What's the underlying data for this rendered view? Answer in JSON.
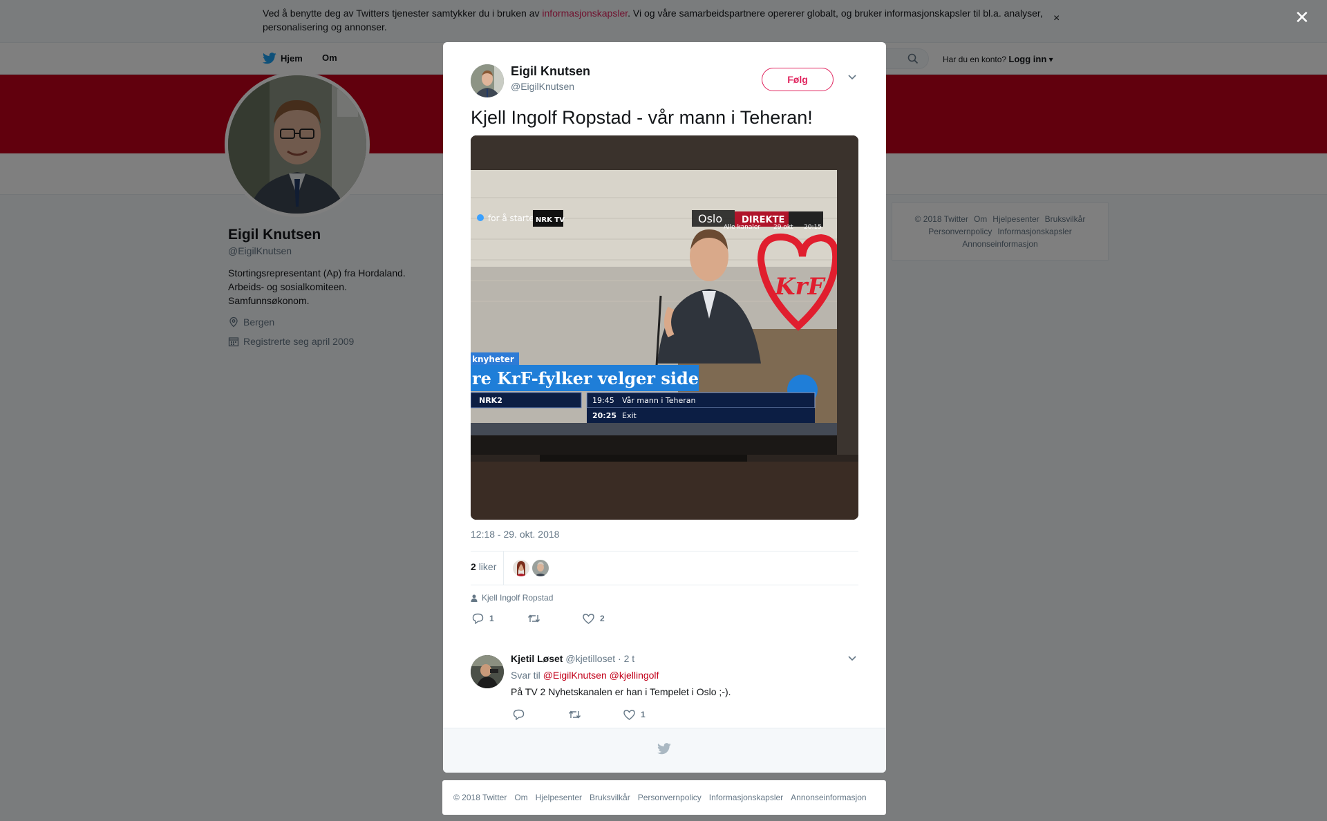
{
  "cookie_bar": {
    "text_before": "Ved å benytte deg av Twitters tjenester samtykker du i bruken av ",
    "link": "informasjonskapsler",
    "text_after": ". Vi og våre samarbeidspartnere opererer globalt, og bruker informasjonskapsler til bl.a. analyser, personalisering og annonser.",
    "close": "×"
  },
  "nav": {
    "home": "Hjem",
    "about": "Om",
    "login_prompt": "Har du en konto?",
    "login": "Logg inn"
  },
  "profile": {
    "name": "Eigil Knutsen",
    "handle": "@EigilKnutsen",
    "bio_lines": [
      "Stortingsrepresentant (Ap) fra Hordaland.",
      "Arbeids- og sosialkomiteen.",
      "Samfunnsøkonom."
    ],
    "location": "Bergen",
    "joined": "Registrerte seg april 2009"
  },
  "side_footer": {
    "row1": [
      "© 2018 Twitter",
      "Om",
      "Hjelpesenter",
      "Bruksvilkår"
    ],
    "row2": [
      "Personvernpolicy",
      "Informasjonskapsler"
    ],
    "row3": [
      "Annonseinformasjon"
    ]
  },
  "tweet": {
    "author_name": "Eigil Knutsen",
    "author_handle": "@EigilKnutsen",
    "follow": "Følg",
    "text": "Kjell Ingolf Ropstad - vår mann i Teheran!",
    "timestamp": "12:18 - 29. okt. 2018",
    "likes_count": "2",
    "likes_label": "liker",
    "tagged": "Kjell Ingolf Ropstad",
    "reply_count": "1",
    "retweet_count": "",
    "like_count": "2"
  },
  "media": {
    "prestart": "for å starte",
    "nrk_tv": "NRK TV",
    "city": "Oslo",
    "live": "DIREKTE",
    "all_channels": "Alle kanaler",
    "date": "29 okt",
    "time_top": "20:15",
    "nyheter": "knyheter",
    "headline": "re KrF-fylker velger side",
    "channel": "NRK2",
    "prog1_time": "19:45",
    "prog1_title": "Vår mann i Teheran",
    "prog2_time": "20:25",
    "prog2_title": "Exit",
    "logo": "KrF"
  },
  "reply": {
    "name": "Kjetil Løset",
    "handle": "@kjetilloset",
    "age": "· 2 t",
    "reply_to_label": "Svar til",
    "mention1": "@EigilKnutsen",
    "mention2": "@kjellingolf",
    "text": "På TV 2 Nyhetskanalen er han i Tempelet i Oslo ;-).",
    "reply_count": "",
    "retweet_count": "",
    "like_count": "1"
  },
  "bottom_footer": [
    "© 2018 Twitter",
    "Om",
    "Hjelpesenter",
    "Bruksvilkår",
    "Personvernpolicy",
    "Informasjonskapsler",
    "Annonseinformasjon"
  ],
  "colors": {
    "brand_red": "#c2001a",
    "like_pink": "#e0245e",
    "twitter_blue": "#1da1f2"
  }
}
